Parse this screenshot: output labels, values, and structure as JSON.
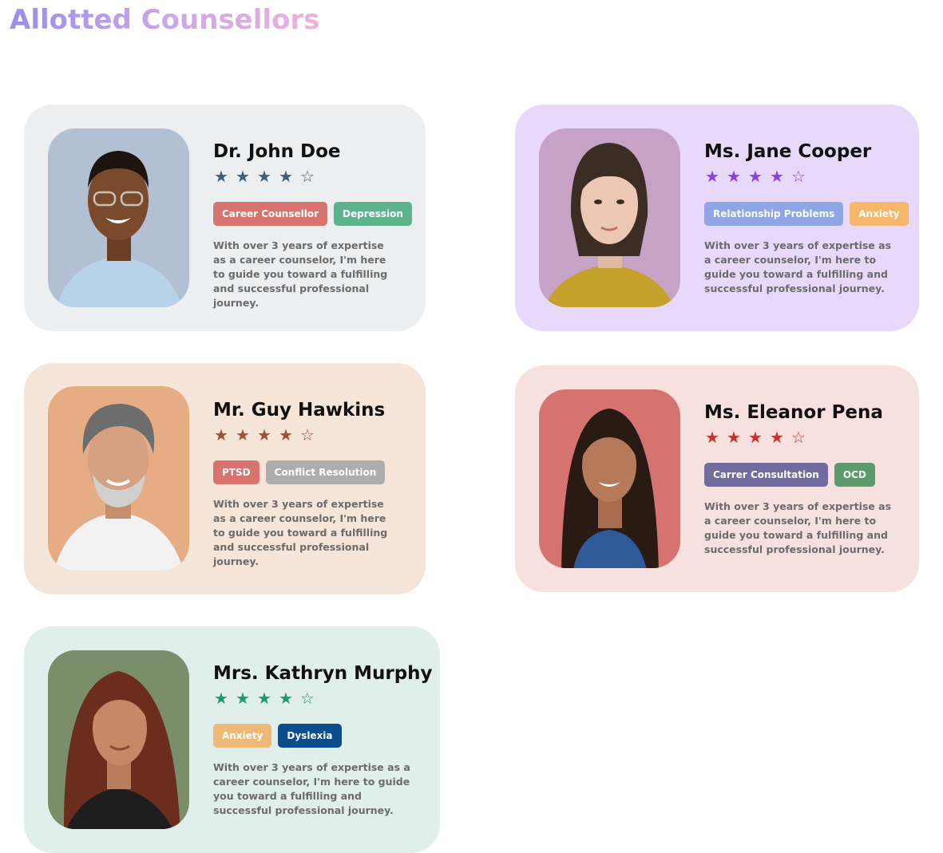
{
  "page": {
    "title": "Allotted Counsellors"
  },
  "counsellors": [
    {
      "name": "Dr. John Doe",
      "rating": 4,
      "rating_max": 5,
      "card_color": "#eceef0",
      "star_color": "#3e5f79",
      "tags": [
        {
          "label": "Career Counsellor",
          "color": "#d9736f"
        },
        {
          "label": "Depression",
          "color": "#5db38d"
        }
      ],
      "description": "With over 3 years of expertise as a career counselor, I'm here to guide you toward a fulfilling and successful professional journey."
    },
    {
      "name": "Ms. Jane Cooper",
      "rating": 4,
      "rating_max": 5,
      "card_color": "#e8d9fb",
      "star_color": "#8b3ef0",
      "tags": [
        {
          "label": "Relationship Problems",
          "color": "#8ea6e6"
        },
        {
          "label": "Anxiety",
          "color": "#f6b76a"
        }
      ],
      "description": "With over 3 years of expertise as a career counselor, I'm here to guide you toward a fulfilling and successful professional journey."
    },
    {
      "name": "Mr. Guy Hawkins",
      "rating": 4,
      "rating_max": 5,
      "card_color": "#f6e5d9",
      "star_color": "#a34e35",
      "tags": [
        {
          "label": "PTSD",
          "color": "#d9736f"
        },
        {
          "label": "Conflict Resolution",
          "color": "#adadad"
        }
      ],
      "description": "With over 3 years of expertise as a career counselor, I'm here to guide you toward a fulfilling and successful professional journey."
    },
    {
      "name": "Ms. Eleanor Pena",
      "rating": 4,
      "rating_max": 5,
      "card_color": "#f7e1df",
      "star_color": "#c9322a",
      "tags": [
        {
          "label": "Carrer Consultation",
          "color": "#716ba0"
        },
        {
          "label": "OCD",
          "color": "#5d9a6c"
        }
      ],
      "description": "With over 3 years of expertise as a career counselor, I'm here to guide you toward a fulfilling and successful professional journey."
    },
    {
      "name": "Mrs. Kathryn Murphy",
      "rating": 4,
      "rating_max": 5,
      "card_color": "#e0efe9",
      "star_color": "#1c9a6d",
      "tags": [
        {
          "label": "Anxiety",
          "color": "#ecb978"
        },
        {
          "label": "Dyslexia",
          "color": "#0b4c8c"
        }
      ],
      "description": "With over 3 years of expertise as a career counselor, I'm here to guide you toward a fulfilling and successful professional journey."
    }
  ],
  "icons": {
    "star_filled": "★",
    "star_empty": "☆"
  }
}
